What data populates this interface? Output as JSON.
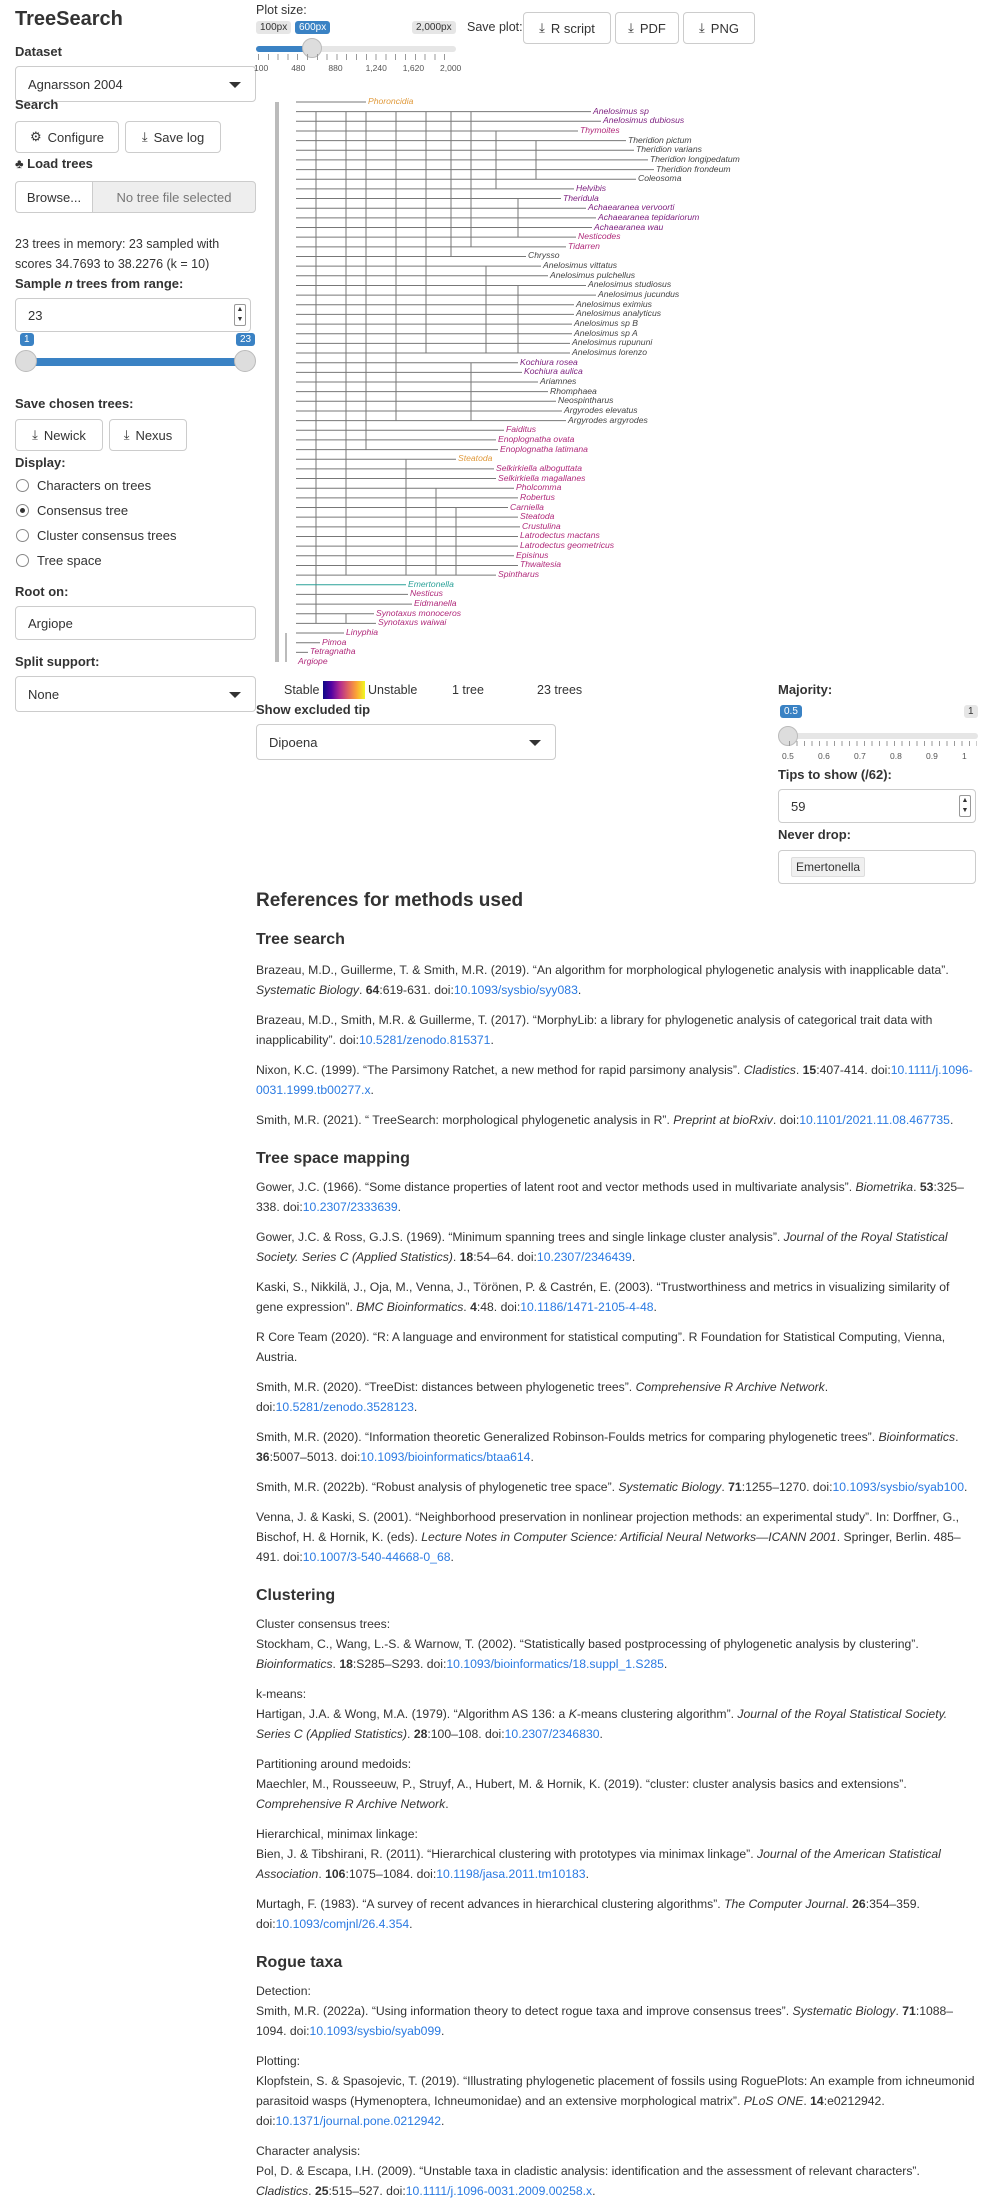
{
  "app": {
    "title": "TreeSearch"
  },
  "sidebar": {
    "dataset_label": "Dataset",
    "dataset_value": "Agnarsson 2004",
    "search_label": "Search",
    "configure": "Configure",
    "save_log": "Save log",
    "load_label": "Load trees",
    "browse": "Browse...",
    "file_placeholder": "No tree file selected",
    "memory_text": "23 trees in memory: 23 sampled with scores 34.7693 to 38.2276 (k = 10)",
    "sample_label_pre": "Sample ",
    "sample_label_n": "n",
    "sample_label_post": " trees from range:",
    "sample_value": "23",
    "range_min": "1",
    "range_max": "23",
    "save_chosen": "Save chosen trees:",
    "newick": "Newick",
    "nexus": "Nexus",
    "display_label": "Display:",
    "display_options": [
      "Characters on trees",
      "Consensus tree",
      "Cluster consensus trees",
      "Tree space"
    ],
    "display_selected": 1,
    "root_label": "Root on:",
    "root_value": "Argiope",
    "split_label": "Split support:",
    "split_value": "None"
  },
  "plot": {
    "size_label": "Plot size:",
    "size_min": "100px",
    "size_val": "600px",
    "size_max": "2,000px",
    "size_ticks": [
      "100",
      "480",
      "880",
      "1,240",
      "1,620",
      "2,000"
    ],
    "save_label": "Save plot:",
    "r_script": "R script",
    "pdf": "PDF",
    "png": "PNG"
  },
  "legend": {
    "stable": "Stable",
    "unstable": "Unstable",
    "one_tree": "1 tree",
    "trees": "23 trees"
  },
  "excluded": {
    "label": "Show excluded tip",
    "value": "Dipoena"
  },
  "majority": {
    "label": "Majority:",
    "value": "0.5",
    "max": "1",
    "ticks": [
      "0.5",
      "0.6",
      "0.7",
      "0.8",
      "0.9",
      "1"
    ]
  },
  "tips": {
    "label": "Tips to show (/62):",
    "value": "59"
  },
  "neverdrop": {
    "label": "Never drop:",
    "value": "Emertonella"
  },
  "colors": {
    "accent": "#3a82c4",
    "purple": "#7b1e7e",
    "magenta": "#b0297a",
    "orange": "#e09a3c",
    "green": "#2aa198",
    "link": "#2a7ae2"
  },
  "tips_list": [
    {
      "name": "Phoroncidia",
      "c": "orange"
    },
    {
      "name": "Anelosimus sp",
      "c": "purple"
    },
    {
      "name": "Anelosimus dubiosus",
      "c": "purple"
    },
    {
      "name": "Thymoites",
      "c": "magenta"
    },
    {
      "name": "Theridion pictum",
      "c": "dark"
    },
    {
      "name": "Theridion varians",
      "c": "dark"
    },
    {
      "name": "Theridion longipedatum",
      "c": "dark"
    },
    {
      "name": "Theridion frondeum",
      "c": "dark"
    },
    {
      "name": "Coleosoma",
      "c": "dark"
    },
    {
      "name": "Helvibis",
      "c": "purple"
    },
    {
      "name": "Theridula",
      "c": "purple"
    },
    {
      "name": "Achaearanea vervoorti",
      "c": "purple"
    },
    {
      "name": "Achaearanea tepidariorum",
      "c": "purple"
    },
    {
      "name": "Achaearanea wau",
      "c": "purple"
    },
    {
      "name": "Nesticodes",
      "c": "magenta"
    },
    {
      "name": "Tidarren",
      "c": "magenta"
    },
    {
      "name": "Chrysso",
      "c": "dark"
    },
    {
      "name": "Anelosimus vittatus",
      "c": "dark"
    },
    {
      "name": "Anelosimus pulchellus",
      "c": "dark"
    },
    {
      "name": "Anelosimus studiosus",
      "c": "dark"
    },
    {
      "name": "Anelosimus jucundus",
      "c": "dark"
    },
    {
      "name": "Anelosimus eximius",
      "c": "dark"
    },
    {
      "name": "Anelosimus analyticus",
      "c": "dark"
    },
    {
      "name": "Anelosimus sp B",
      "c": "dark"
    },
    {
      "name": "Anelosimus sp A",
      "c": "dark"
    },
    {
      "name": "Anelosimus rupununi",
      "c": "dark"
    },
    {
      "name": "Anelosimus lorenzo",
      "c": "dark"
    },
    {
      "name": "Kochiura rosea",
      "c": "purple"
    },
    {
      "name": "Kochiura aulica",
      "c": "purple"
    },
    {
      "name": "Ariamnes",
      "c": "dark"
    },
    {
      "name": "Rhomphaea",
      "c": "dark"
    },
    {
      "name": "Neospintharus",
      "c": "dark"
    },
    {
      "name": "Argyrodes elevatus",
      "c": "dark"
    },
    {
      "name": "Argyrodes argyrodes",
      "c": "dark"
    },
    {
      "name": "Faiditus",
      "c": "magenta"
    },
    {
      "name": "Enoplognatha ovata",
      "c": "magenta"
    },
    {
      "name": "Enoplognatha latimana",
      "c": "magenta"
    },
    {
      "name": "Steatoda",
      "c": "orange"
    },
    {
      "name": "Selkirkiella alboguttata",
      "c": "magenta"
    },
    {
      "name": "Selkirkiella magallanes",
      "c": "magenta"
    },
    {
      "name": "Pholcomma",
      "c": "magenta"
    },
    {
      "name": "Robertus",
      "c": "magenta"
    },
    {
      "name": "Carniella",
      "c": "magenta"
    },
    {
      "name": "Steatoda",
      "c": "magenta"
    },
    {
      "name": "Crustulina",
      "c": "magenta"
    },
    {
      "name": "Latrodectus mactans",
      "c": "magenta"
    },
    {
      "name": "Latrodectus geometricus",
      "c": "magenta"
    },
    {
      "name": "Episinus",
      "c": "magenta"
    },
    {
      "name": "Thwaitesia",
      "c": "magenta"
    },
    {
      "name": "Spintharus",
      "c": "magenta"
    },
    {
      "name": "Emertonella",
      "c": "green"
    },
    {
      "name": "Nesticus",
      "c": "magenta"
    },
    {
      "name": "Eidmanella",
      "c": "magenta"
    },
    {
      "name": "Synotaxus monoceros",
      "c": "magenta"
    },
    {
      "name": "Synotaxus waiwai",
      "c": "magenta"
    },
    {
      "name": "Linyphia",
      "c": "magenta"
    },
    {
      "name": "Pimoa",
      "c": "magenta"
    },
    {
      "name": "Tetragnatha",
      "c": "magenta"
    },
    {
      "name": "Argiope",
      "c": "magenta"
    }
  ],
  "refs": {
    "title": "References for methods used",
    "s_tree": "Tree search",
    "r1a": "Brazeau, M.D., Guillerme, T. & Smith, M.R. (2019). “An algorithm for morphological phylogenetic analysis with inapplicable data”. ",
    "r1b": "Systematic Biology",
    "r1c": ". ",
    "r1d": "64",
    "r1e": ":619-631. doi:",
    "r1f": "10.1093/sysbio/syy083",
    "r1g": ".",
    "r2a": "Brazeau, M.D., Smith, M.R. & Guillerme, T. (2017). “MorphyLib: a library for phylogenetic analysis of categorical trait data with inapplicability”. doi:",
    "r2b": "10.5281/zenodo.815371",
    "r2c": ".",
    "r3a": "Nixon, K.C. (1999). “The Parsimony Ratchet, a new method for rapid parsimony analysis”. ",
    "r3b": "Cladistics",
    "r3c": ". ",
    "r3d": "15",
    "r3e": ":407-414. doi:",
    "r3f": "10.1111/j.1096-0031.1999.tb00277.x",
    "r3g": ".",
    "r4a": "Smith, M.R. (2021). “ TreeSearch: morphological phylogenetic analysis in R”. ",
    "r4b": "Preprint at bioRxiv",
    "r4c": ". doi:",
    "r4d": "10.1101/2021.11.08.467735",
    "r4e": ".",
    "s_space": "Tree space mapping",
    "r5a": "Gower, J.C. (1966). “Some distance properties of latent root and vector methods used in multivariate analysis”. ",
    "r5b": "Biometrika",
    "r5c": ". ",
    "r5d": "53",
    "r5e": ":325–338. doi:",
    "r5f": "10.2307/2333639",
    "r5g": ".",
    "r6a": "Gower, J.C. & Ross, G.J.S. (1969). “Minimum spanning trees and single linkage cluster analysis”. ",
    "r6b": "Journal of the Royal Statistical Society. Series C (Applied Statistics)",
    "r6c": ". ",
    "r6d": "18",
    "r6e": ":54–64. doi:",
    "r6f": "10.2307/2346439",
    "r6g": ".",
    "r7a": "Kaski, S., Nikkilä, J., Oja, M., Venna, J., Törönen, P. & Castrén, E. (2003). “Trustworthiness and metrics in visualizing similarity of gene expression”. ",
    "r7b": "BMC Bioinformatics",
    "r7c": ". ",
    "r7d": "4",
    "r7e": ":48. doi:",
    "r7f": "10.1186/1471-2105-4-48",
    "r7g": ".",
    "r8": "R Core Team (2020). “R: A language and environment for statistical computing”. R Foundation for Statistical Computing, Vienna, Austria.",
    "r9a": "Smith, M.R. (2020). “TreeDist: distances between phylogenetic trees”. ",
    "r9b": "Comprehensive R Archive Network",
    "r9c": ". doi:",
    "r9d": "10.5281/zenodo.3528123",
    "r9e": ".",
    "r10a": "Smith, M.R. (2020). “Information theoretic Generalized Robinson-Foulds metrics for comparing phylogenetic trees”. ",
    "r10b": "Bioinformatics",
    "r10c": ". ",
    "r10d": "36",
    "r10e": ":5007–5013. doi:",
    "r10f": "10.1093/bioinformatics/btaa614",
    "r10g": ".",
    "r11a": "Smith, M.R. (2022b). “Robust analysis of phylogenetic tree space”. ",
    "r11b": "Systematic Biology",
    "r11c": ". ",
    "r11d": "71",
    "r11e": ":1255–1270. doi:",
    "r11f": "10.1093/sysbio/syab100",
    "r11g": ".",
    "r12a": "Venna, J. & Kaski, S. (2001). “Neighborhood preservation in nonlinear projection methods: an experimental study”. In: Dorffner, G., Bischof, H. & Hornik, K. (eds). ",
    "r12b": "Lecture Notes in Computer Science: Artificial Neural Networks—ICANN 2001",
    "r12c": ". Springer, Berlin. 485–491. doi:",
    "r12d": "10.1007/3-540-44668-0_68",
    "r12e": ".",
    "s_clust": "Clustering",
    "c1h": "Cluster consensus trees:",
    "c1a": "Stockham, C., Wang, L.-S. & Warnow, T. (2002). “Statistically based postprocessing of phylogenetic analysis by clustering”. ",
    "c1b": "Bioinformatics",
    "c1c": ". ",
    "c1d": "18",
    "c1e": ":S285–S293. doi:",
    "c1f": "10.1093/bioinformatics/18.suppl_1.S285",
    "c1g": ".",
    "c2h": "k-means:",
    "c2a": "Hartigan, J.A. & Wong, M.A. (1979). “Algorithm AS 136: a ",
    "c2k": "K",
    "c2a2": "-means clustering algorithm”. ",
    "c2b": "Journal of the Royal Statistical Society. Series C (Applied Statistics)",
    "c2c": ". ",
    "c2d": "28",
    "c2e": ":100–108. doi:",
    "c2f": "10.2307/2346830",
    "c2g": ".",
    "c3h": "Partitioning around medoids:",
    "c3a": "Maechler, M., Rousseeuw, P., Struyf, A., Hubert, M. & Hornik, K. (2019). “cluster: cluster analysis basics and extensions”. ",
    "c3b": "Comprehensive R Archive Network",
    "c3c": ".",
    "c4h": "Hierarchical, minimax linkage:",
    "c4a": "Bien, J. & Tibshirani, R. (2011). “Hierarchical clustering with prototypes via minimax linkage”. ",
    "c4b": "Journal of the American Statistical Association",
    "c4c": ". ",
    "c4d": "106",
    "c4e": ":1075–1084. doi:",
    "c4f": "10.1198/jasa.2011.tm10183",
    "c4g": ".",
    "c5a": "Murtagh, F. (1983). “A survey of recent advances in hierarchical clustering algorithms”. ",
    "c5b": "The Computer Journal",
    "c5c": ". ",
    "c5d": "26",
    "c5e": ":354–359. doi:",
    "c5f": "10.1093/comjnl/26.4.354",
    "c5g": ".",
    "s_rogue": "Rogue taxa",
    "g1h": "Detection:",
    "g1a": "Smith, M.R. (2022a). “Using information theory to detect rogue taxa and improve consensus trees”. ",
    "g1b": "Systematic Biology",
    "g1c": ". ",
    "g1d": "71",
    "g1e": ":1088–1094. doi:",
    "g1f": "10.1093/sysbio/syab099",
    "g1g": ".",
    "g2h": "Plotting:",
    "g2a": "Klopfstein, S. & Spasojevic, T. (2019). “Illustrating phylogenetic placement of fossils using RoguePlots: An example from ichneumonid parasitoid wasps (Hymenoptera, Ichneumonidae) and an extensive morphological matrix”. ",
    "g2b": "PLoS ONE",
    "g2c": ". ",
    "g2d": "14",
    "g2e": ":e0212942. doi:",
    "g2f": "10.1371/journal.pone.0212942",
    "g2g": ".",
    "g3h": "Character analysis:",
    "g3a": "Pol, D. & Escapa, I.H. (2009). “Unstable taxa in cladistic analysis: identification and the assessment of relevant characters”. ",
    "g3b": "Cladistics",
    "g3c": ". ",
    "g3d": "25",
    "g3e": ":515–527. doi:",
    "g3f": "10.1111/j.1096-0031.2009.00258.x",
    "g3g": "."
  }
}
